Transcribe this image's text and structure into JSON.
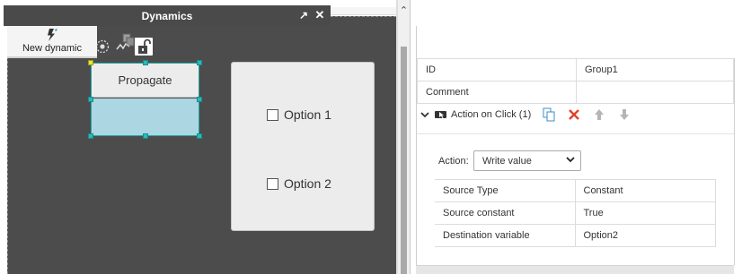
{
  "editor": {
    "widget": {
      "label": "Propagate"
    },
    "options": [
      {
        "label": "Option 1",
        "checked": false
      },
      {
        "label": "Option 2",
        "checked": false
      }
    ],
    "toolbar_icons": [
      "gear-icon",
      "trend-icon",
      "lock-icon"
    ]
  },
  "panel": {
    "title": "Dynamics",
    "new_dynamic_label": "New dynamic",
    "properties": [
      {
        "key": "ID",
        "value": "Group1"
      },
      {
        "key": "Comment",
        "value": ""
      }
    ],
    "action": {
      "title": "Action on Click (1)",
      "label": "Action:",
      "selected": "Write value",
      "rows": [
        {
          "key": "Source Type",
          "value": "Constant"
        },
        {
          "key": "Source constant",
          "value": "True"
        },
        {
          "key": "Destination variable",
          "value": "Option2"
        }
      ]
    }
  },
  "colors": {
    "canvas_bg": "#4c4c4c",
    "selection": "#22a6a6",
    "widget_fill": "#acd6e2",
    "panel_header": "#4a4a4a",
    "delete_red": "#e0412b"
  }
}
